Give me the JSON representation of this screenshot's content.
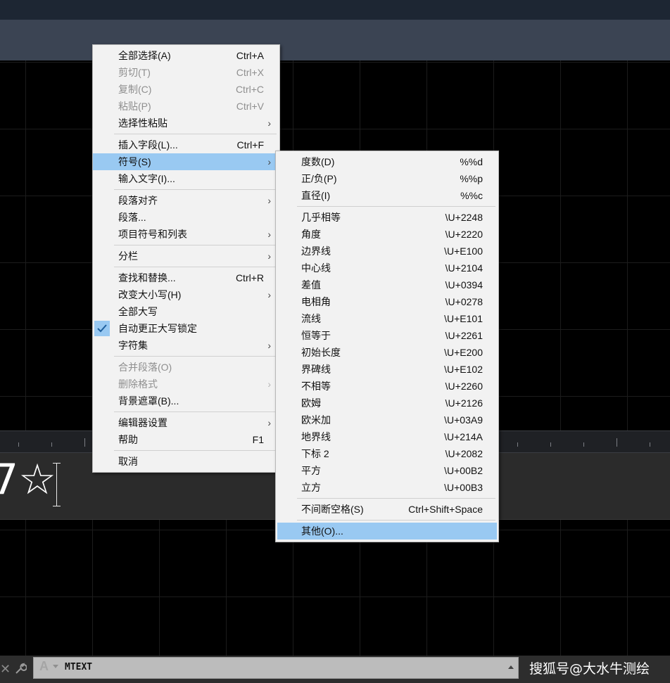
{
  "context_menu": {
    "items": [
      {
        "label": "全部选择(A)",
        "shortcut": "Ctrl+A"
      },
      {
        "label": "剪切(T)",
        "shortcut": "Ctrl+X"
      },
      {
        "label": "复制(C)",
        "shortcut": "Ctrl+C"
      },
      {
        "label": "粘贴(P)",
        "shortcut": "Ctrl+V"
      },
      {
        "label": "选择性粘贴",
        "arrow": "›"
      },
      {
        "label": "插入字段(L)...",
        "shortcut": "Ctrl+F"
      },
      {
        "label": "符号(S)",
        "arrow": "›"
      },
      {
        "label": "输入文字(I)..."
      },
      {
        "label": "段落对齐",
        "arrow": "›"
      },
      {
        "label": "段落..."
      },
      {
        "label": "项目符号和列表",
        "arrow": "›"
      },
      {
        "label": "分栏",
        "arrow": "›"
      },
      {
        "label": "查找和替换...",
        "shortcut": "Ctrl+R"
      },
      {
        "label": "改变大小写(H)",
        "arrow": "›"
      },
      {
        "label": "全部大写"
      },
      {
        "label": "自动更正大写锁定"
      },
      {
        "label": "字符集",
        "arrow": "›"
      },
      {
        "label": "合并段落(O)"
      },
      {
        "label": "删除格式",
        "arrow": "›"
      },
      {
        "label": "背景遮罩(B)..."
      },
      {
        "label": "编辑器设置",
        "arrow": "›"
      },
      {
        "label": "帮助",
        "shortcut": "F1"
      },
      {
        "label": "取消"
      }
    ]
  },
  "symbol_menu": {
    "items": [
      {
        "label": "度数(D)",
        "shortcut": "%%d"
      },
      {
        "label": "正/负(P)",
        "shortcut": "%%p"
      },
      {
        "label": "直径(I)",
        "shortcut": "%%c"
      },
      {
        "label": "几乎相等",
        "shortcut": "\\U+2248"
      },
      {
        "label": "角度",
        "shortcut": "\\U+2220"
      },
      {
        "label": "边界线",
        "shortcut": "\\U+E100"
      },
      {
        "label": "中心线",
        "shortcut": "\\U+2104"
      },
      {
        "label": "差值",
        "shortcut": "\\U+0394"
      },
      {
        "label": "电相角",
        "shortcut": "\\U+0278"
      },
      {
        "label": "流线",
        "shortcut": "\\U+E101"
      },
      {
        "label": "恒等于",
        "shortcut": "\\U+2261"
      },
      {
        "label": "初始长度",
        "shortcut": "\\U+E200"
      },
      {
        "label": "界碑线",
        "shortcut": "\\U+E102"
      },
      {
        "label": "不相等",
        "shortcut": "\\U+2260"
      },
      {
        "label": "欧姆",
        "shortcut": "\\U+2126"
      },
      {
        "label": "欧米加",
        "shortcut": "\\U+03A9"
      },
      {
        "label": "地界线",
        "shortcut": "\\U+214A"
      },
      {
        "label": "下标 2",
        "shortcut": "\\U+2082"
      },
      {
        "label": "平方",
        "shortcut": "\\U+00B2"
      },
      {
        "label": "立方",
        "shortcut": "\\U+00B3"
      },
      {
        "label": "不间断空格(S)",
        "shortcut": "Ctrl+Shift+Space"
      },
      {
        "label": "其他(O)..."
      }
    ]
  },
  "editor": {
    "text": "7☆"
  },
  "command_line": {
    "font_icon": "A",
    "command": "MTEXT"
  },
  "watermark": "搜狐号@大水牛测绘",
  "colors": {
    "menu_bg": "#f2f2f2",
    "menu_highlight": "#99c9f2",
    "disabled_text": "#8f8f8f"
  }
}
